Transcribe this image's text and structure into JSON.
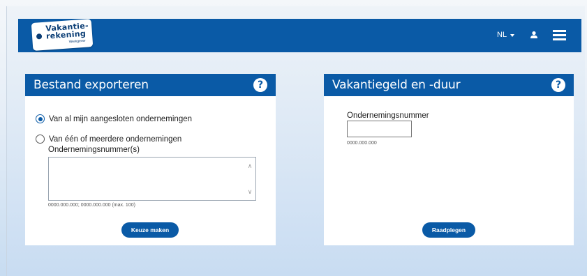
{
  "header": {
    "logo": {
      "line1": "Vakantie-",
      "line2": "rekening",
      "line3": "Werkgever"
    },
    "language": "NL"
  },
  "export_card": {
    "title": "Bestand exporteren",
    "help": "?",
    "option_all": "Van al mijn aangesloten ondernemingen",
    "option_some": "Van één of meerdere ondernemingen",
    "field_label": "Ondernemingsnummer(s)",
    "field_value": "",
    "hint": "0000.000.000; 0000.000.000 (max. 100)",
    "button": "Keuze maken"
  },
  "vacation_card": {
    "title": "Vakantiegeld en -duur",
    "help": "?",
    "field_label": "Ondernemingsnummer",
    "field_value": "",
    "hint": "0000.000.000",
    "button": "Raadplegen"
  },
  "colors": {
    "brand": "#0a5aa6",
    "logo_text": "#0a3d75"
  }
}
